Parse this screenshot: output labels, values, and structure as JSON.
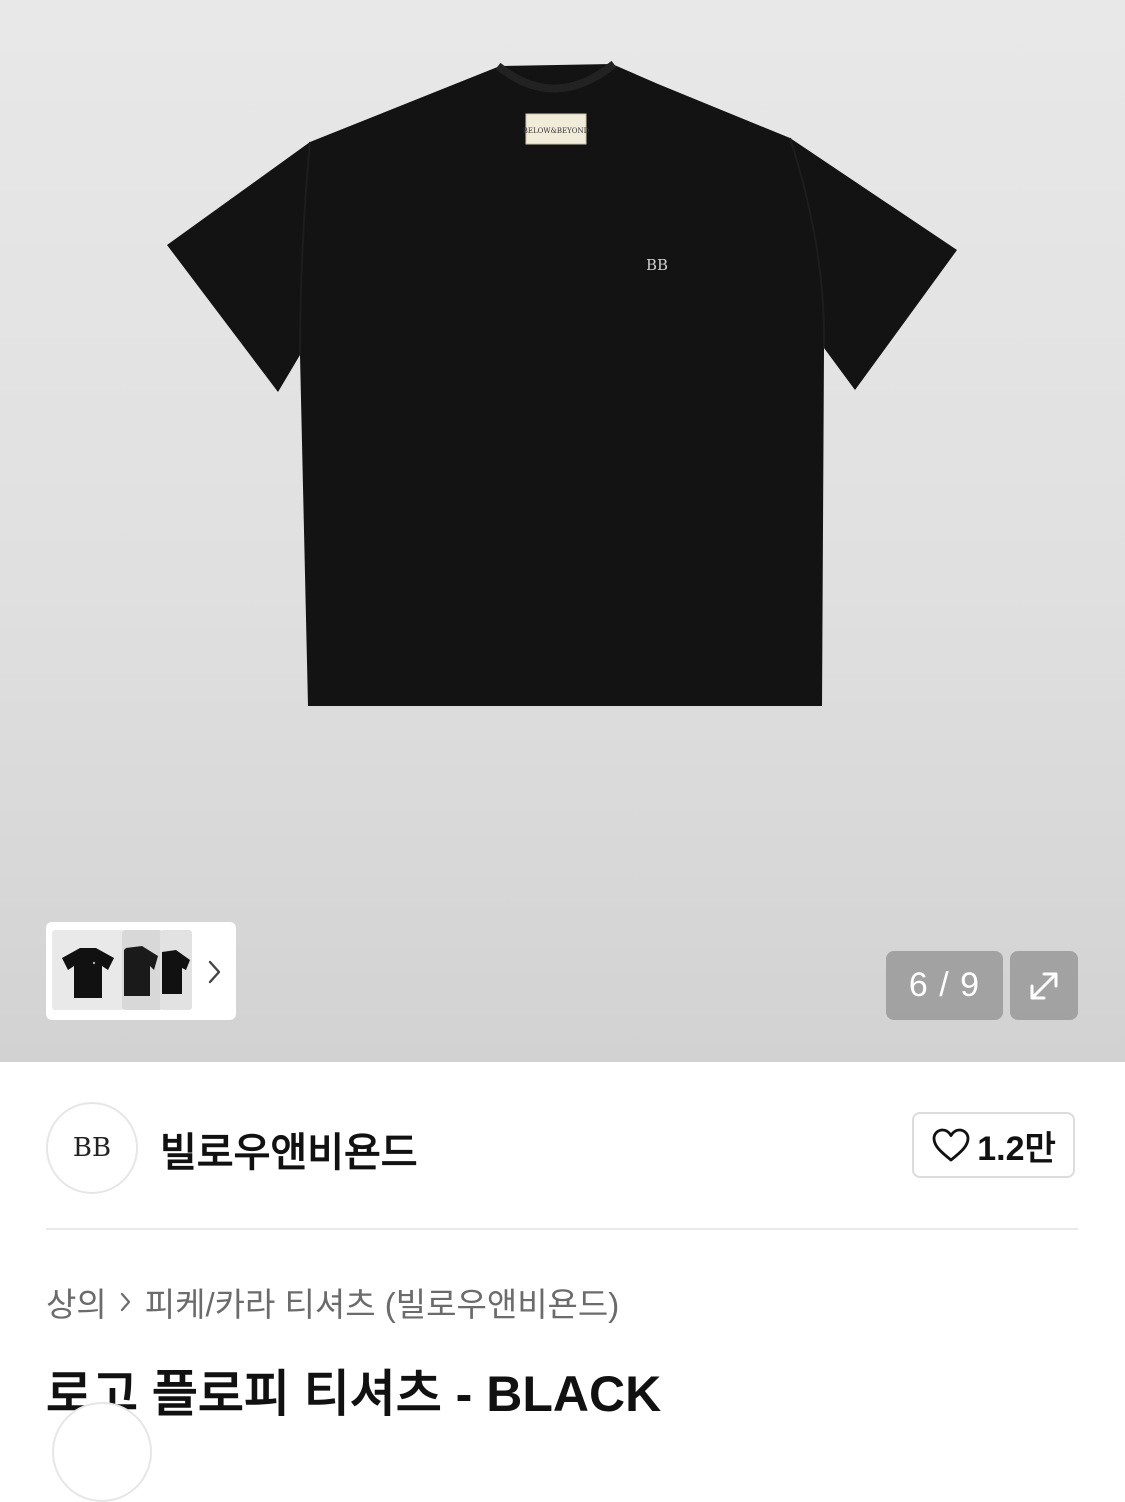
{
  "gallery": {
    "counter": "6 / 9",
    "neck_label_text": "BELOW&BEYOND",
    "chest_logo_text": "BB"
  },
  "brand": {
    "logo_text": "BB",
    "name": "빌로우앤비욘드",
    "like_count": "1.2만"
  },
  "breadcrumb": {
    "level1": "상의",
    "level2": "피케/카라 티셔츠 (빌로우앤비욘드)"
  },
  "product": {
    "title": "로고 플로피 티셔츠 - BLACK"
  },
  "colors": {
    "shirt": "#131313",
    "gallery_bg": "#e4e4e4",
    "overlay": "#8a8a8a"
  }
}
